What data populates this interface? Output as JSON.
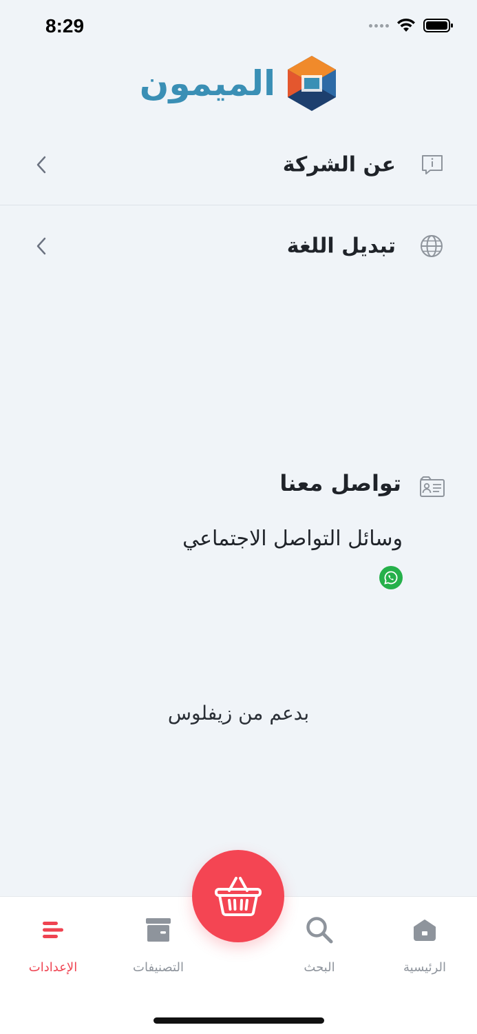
{
  "status_bar": {
    "time": "8:29"
  },
  "brand": {
    "name": "الميمون"
  },
  "menu": {
    "about": "عن الشركة",
    "language": "تبديل اللغة"
  },
  "contact": {
    "title": "تواصل معنا",
    "social_label": "وسائل التواصل الاجتماعي",
    "social_icons": [
      "whatsapp-icon"
    ]
  },
  "footer": {
    "powered_by": "بدعم من زيفلوس"
  },
  "tabbar": {
    "settings": "الإعدادات",
    "categories": "التصنيفات",
    "search": "البحث",
    "home": "الرئيسية",
    "active": "settings"
  },
  "colors": {
    "accent": "#f44553",
    "brand_blue": "#3a8fb5",
    "background": "#f0f4f8",
    "whatsapp": "#25b04a",
    "inactive": "#8e949c"
  }
}
